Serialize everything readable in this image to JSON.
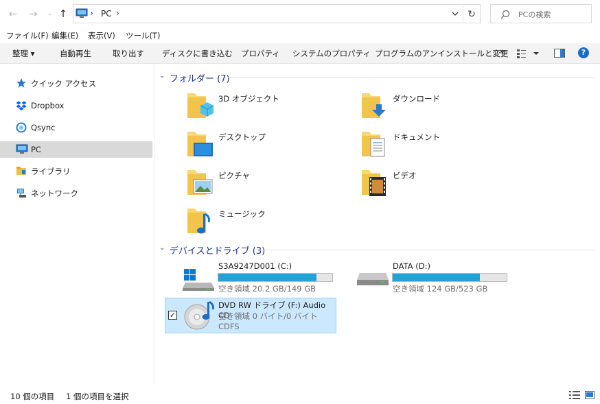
{
  "address": {
    "crumbs": [
      "PC"
    ],
    "search_placeholder": "PCの検索"
  },
  "menu": [
    "ファイル(F)",
    "編集(E)",
    "表示(V)",
    "ツール(T)"
  ],
  "commands": {
    "organize": "整理 ▾",
    "autoplay": "自動再生",
    "eject": "取り出す",
    "burn": "ディスクに書き込む",
    "properties": "プロパティ",
    "system_properties": "システムのプロパティ",
    "uninstall": "プログラムのアンインストールと変更",
    "more": "»"
  },
  "sidebar": {
    "items": [
      {
        "label": "クイック アクセス",
        "icon": "star-icon"
      },
      {
        "label": "Dropbox",
        "icon": "dropbox-icon"
      },
      {
        "label": "Qsync",
        "icon": "qsync-icon"
      },
      {
        "label": "PC",
        "icon": "pc-icon",
        "selected": true
      },
      {
        "label": "ライブラリ",
        "icon": "library-icon"
      },
      {
        "label": "ネットワーク",
        "icon": "network-icon"
      }
    ]
  },
  "folders_group": {
    "title": "フォルダー (7)",
    "items": [
      {
        "label": "3D オブジェクト",
        "icon": "3d-objects-folder-icon"
      },
      {
        "label": "ダウンロード",
        "icon": "downloads-folder-icon"
      },
      {
        "label": "デスクトップ",
        "icon": "desktop-folder-icon"
      },
      {
        "label": "ドキュメント",
        "icon": "documents-folder-icon"
      },
      {
        "label": "ピクチャ",
        "icon": "pictures-folder-icon"
      },
      {
        "label": "ビデオ",
        "icon": "videos-folder-icon"
      },
      {
        "label": "ミュージック",
        "icon": "music-folder-icon"
      }
    ]
  },
  "devices_group": {
    "title": "デバイスとドライブ (3)",
    "drives": [
      {
        "name": "S3A9247D001 (C:)",
        "free": "空き領域 20.2 GB/149 GB",
        "used_fraction": 0.864,
        "icon": "windows-drive-icon"
      },
      {
        "name": "DATA (D:)",
        "free": "空き領域 124 GB/523 GB",
        "used_fraction": 0.763,
        "icon": "hard-drive-icon"
      },
      {
        "name": "DVD RW ドライブ (F:) Audio CD",
        "free": "空き領域 0 バイト/0 バイト",
        "fs": "CDFS",
        "icon": "audio-cd-icon",
        "selected": true
      }
    ]
  },
  "status": {
    "count": "10 個の項目",
    "selected": "1 個の項目を選択"
  },
  "colors": {
    "accent": "#26a0da",
    "selection": "#cce8ff",
    "group_title": "#1e3287"
  }
}
